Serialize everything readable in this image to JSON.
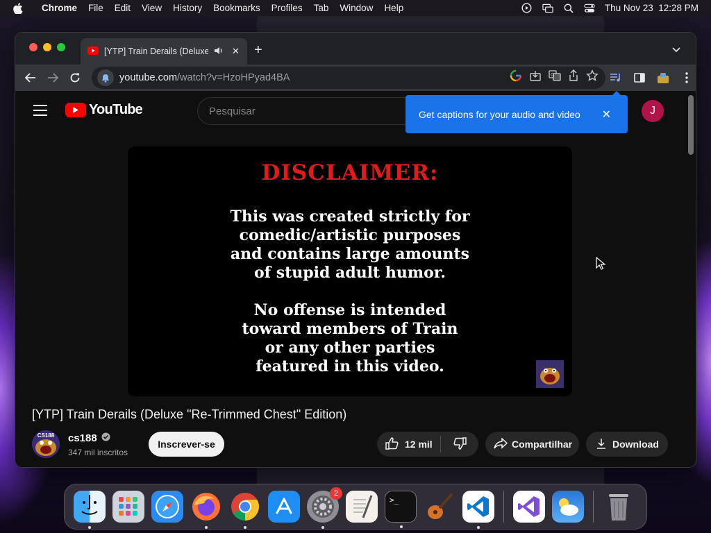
{
  "menubar": {
    "app_name": "Chrome",
    "items": [
      "File",
      "Edit",
      "View",
      "History",
      "Bookmarks",
      "Profiles",
      "Tab",
      "Window",
      "Help"
    ],
    "datetime": "Thu Nov 23  12:28 PM",
    "status_icons": [
      "screen-record-icon",
      "screen-mirroring-icon",
      "search-icon",
      "control-center-icon"
    ]
  },
  "browser": {
    "tab_title": "[YTP] Train Derails (Deluxe",
    "url_domain": "youtube.com",
    "url_path": "/watch?v=HzoHPyad4BA"
  },
  "youtube": {
    "logo_text": "YouTube",
    "search_placeholder": "Pesquisar",
    "account_initial": "J",
    "tooltip_text": "Get captions for your audio and video",
    "tooltip_close": "✕",
    "video": {
      "disclaimer_title": "DISCLAIMER:",
      "paragraph1": [
        "This was created strictly for",
        "comedic/artistic purposes",
        "and contains large amounts",
        "of stupid adult humor."
      ],
      "paragraph2": [
        "No offense is intended",
        "toward members of Train",
        "or any other parties",
        "featured in this video."
      ]
    },
    "video_title": "[YTP] Train Derails (Deluxe \"Re-Trimmed Chest\" Edition)",
    "channel": {
      "name": "cs188",
      "avatar_text": "CS188",
      "subscribers": "347 mil inscritos"
    },
    "subscribe_label": "Inscrever-se",
    "likes": "12 mil",
    "share_label": "Compartilhar",
    "download_label": "Download"
  },
  "dock": {
    "apps": [
      "finder",
      "launchpad",
      "safari",
      "firefox",
      "chrome",
      "app-store",
      "system-settings",
      "textedit",
      "terminal",
      "garageband",
      "vscode",
      "visual-studio",
      "weather",
      "trash"
    ],
    "system_settings_badge": "2",
    "terminal_glyph": ">_"
  },
  "colors": {
    "youtube_red": "#ff0000",
    "tooltip_blue": "#1a73e8",
    "disclaimer_red": "#e01b1b",
    "avatar_pink": "#b1124a"
  }
}
